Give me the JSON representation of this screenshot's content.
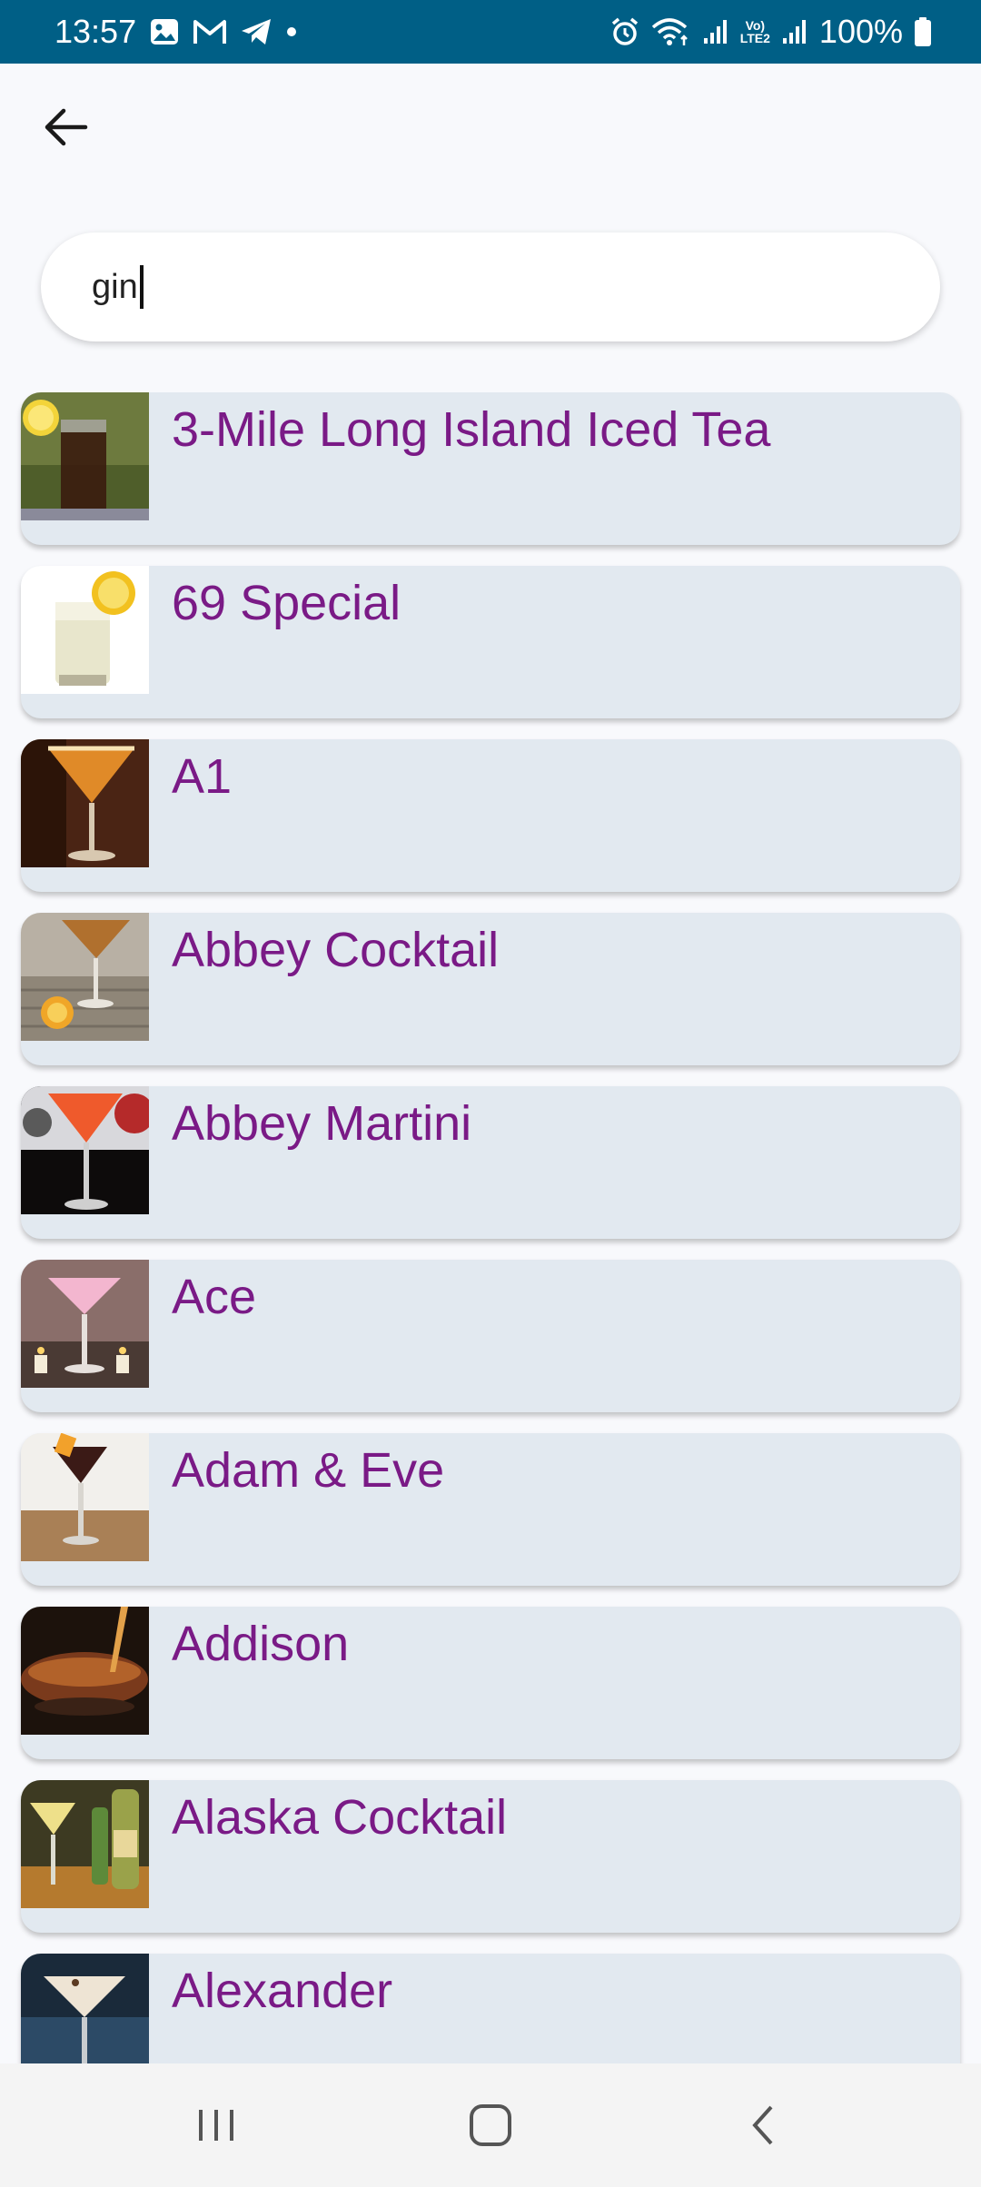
{
  "status_bar": {
    "time": "13:57",
    "battery": "100%",
    "lte_label": "LTE2",
    "volte_label": "Vo)"
  },
  "search": {
    "value": "gin",
    "placeholder": ""
  },
  "cocktails": [
    {
      "name": "3-Mile Long Island Iced Tea",
      "thumb": "iced-tea-thumb"
    },
    {
      "name": "69 Special",
      "thumb": "lemon-drink-thumb"
    },
    {
      "name": "A1",
      "thumb": "martini-orange-thumb"
    },
    {
      "name": "Abbey Cocktail",
      "thumb": "cocktail-wood-thumb"
    },
    {
      "name": "Abbey Martini",
      "thumb": "martini-red-thumb"
    },
    {
      "name": "Ace",
      "thumb": "pink-martini-thumb"
    },
    {
      "name": "Adam & Eve",
      "thumb": "dark-cocktail-thumb"
    },
    {
      "name": "Addison",
      "thumb": "amber-pour-thumb"
    },
    {
      "name": "Alaska Cocktail",
      "thumb": "bottles-thumb"
    },
    {
      "name": "Alexander",
      "thumb": "cream-cocktail-thumb"
    }
  ],
  "colors": {
    "status_bar": "#005f86",
    "item_label": "#7a1a86",
    "item_bg": "#e2e9f0"
  }
}
